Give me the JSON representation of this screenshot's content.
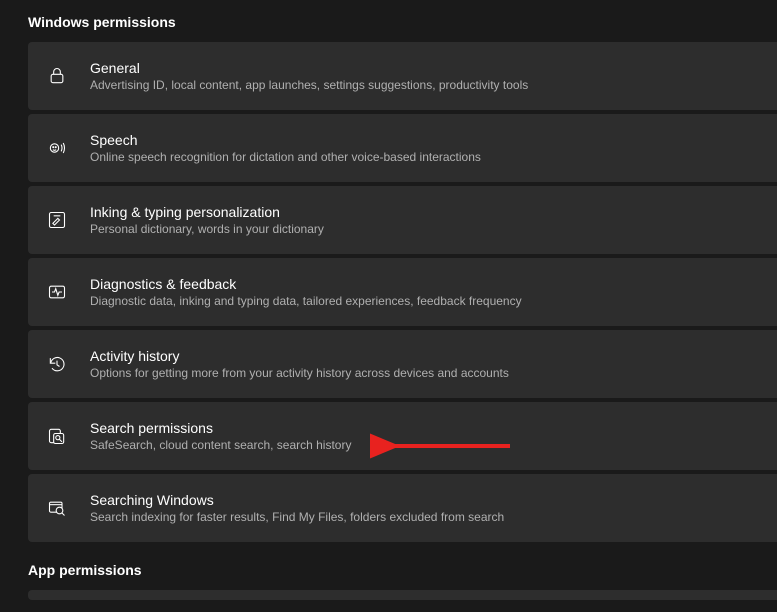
{
  "sections": {
    "windows_permissions": {
      "header": "Windows permissions",
      "items": [
        {
          "title": "General",
          "subtitle": "Advertising ID, local content, app launches, settings suggestions, productivity tools"
        },
        {
          "title": "Speech",
          "subtitle": "Online speech recognition for dictation and other voice-based interactions"
        },
        {
          "title": "Inking & typing personalization",
          "subtitle": "Personal dictionary, words in your dictionary"
        },
        {
          "title": "Diagnostics & feedback",
          "subtitle": "Diagnostic data, inking and typing data, tailored experiences, feedback frequency"
        },
        {
          "title": "Activity history",
          "subtitle": "Options for getting more from your activity history across devices and accounts"
        },
        {
          "title": "Search permissions",
          "subtitle": "SafeSearch, cloud content search, search history"
        },
        {
          "title": "Searching Windows",
          "subtitle": "Search indexing for faster results, Find My Files, folders excluded from search"
        }
      ]
    },
    "app_permissions": {
      "header": "App permissions"
    }
  }
}
